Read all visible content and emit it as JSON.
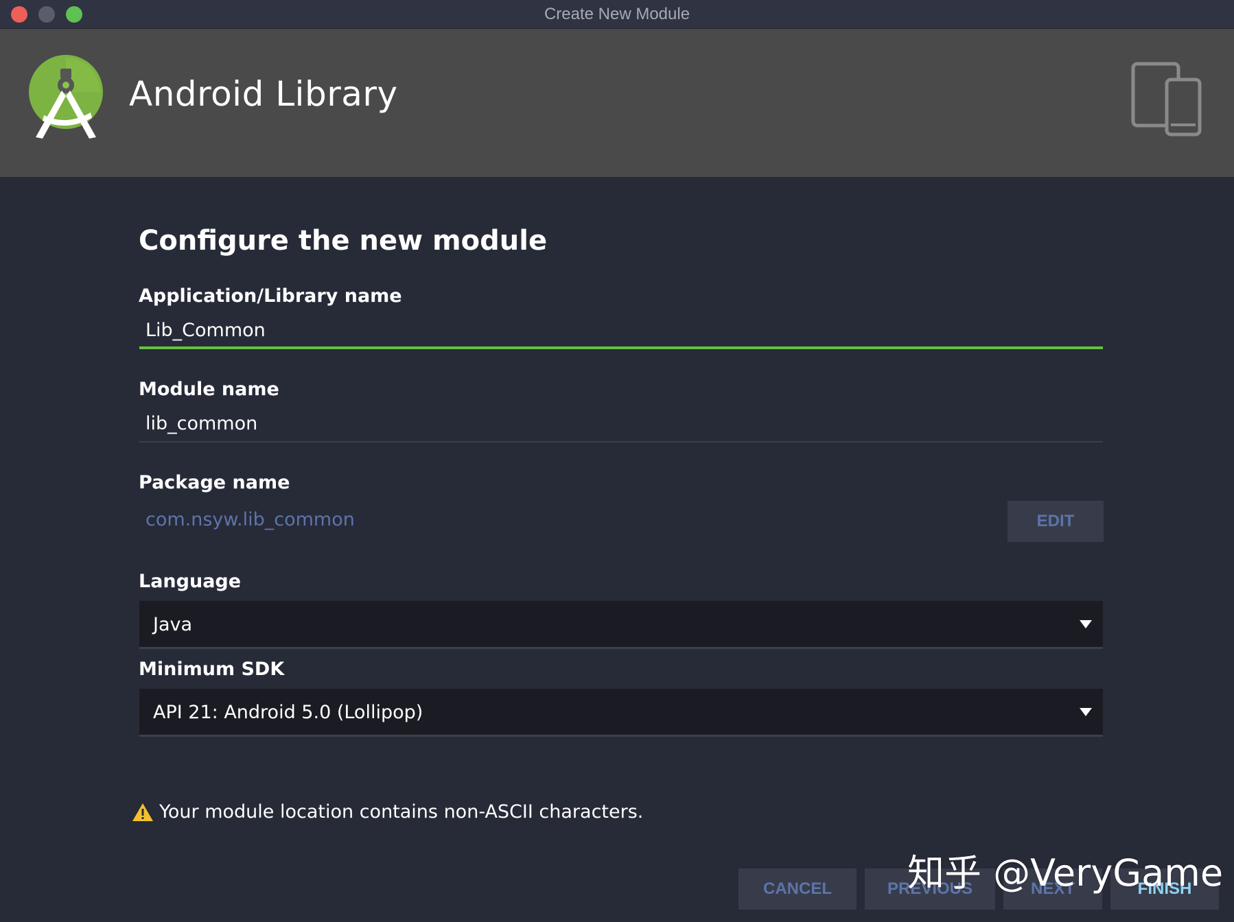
{
  "window": {
    "title": "Create New Module"
  },
  "header": {
    "title": "Android Library",
    "logo_icon": "android-studio-logo-icon",
    "devices_icon": "phone-tablet-icon"
  },
  "form": {
    "section_title": "Configure the new module",
    "app_name": {
      "label": "Application/Library name",
      "value": "Lib_Common"
    },
    "module_name": {
      "label": "Module name",
      "value": "lib_common"
    },
    "package_name": {
      "label": "Package name",
      "value": "com.nsyw.lib_common",
      "edit_label": "EDIT"
    },
    "language": {
      "label": "Language",
      "value": "Java"
    },
    "min_sdk": {
      "label": "Minimum SDK",
      "value": "API 21: Android 5.0 (Lollipop)"
    }
  },
  "warning": {
    "icon": "warning-triangle-icon",
    "text": "Your module location contains non-ASCII characters."
  },
  "buttons": {
    "cancel": "CANCEL",
    "previous": "PREVIOUS",
    "next": "NEXT",
    "finish": "FINISH"
  },
  "watermark": "知乎 @VeryGame",
  "colors": {
    "accent_green": "#63c341",
    "background": "#272a37",
    "header_bg": "#4a4a4a",
    "muted_blue": "#5d74aa",
    "finish_blue": "#8fd3f5",
    "warning_yellow": "#f2c12e"
  }
}
